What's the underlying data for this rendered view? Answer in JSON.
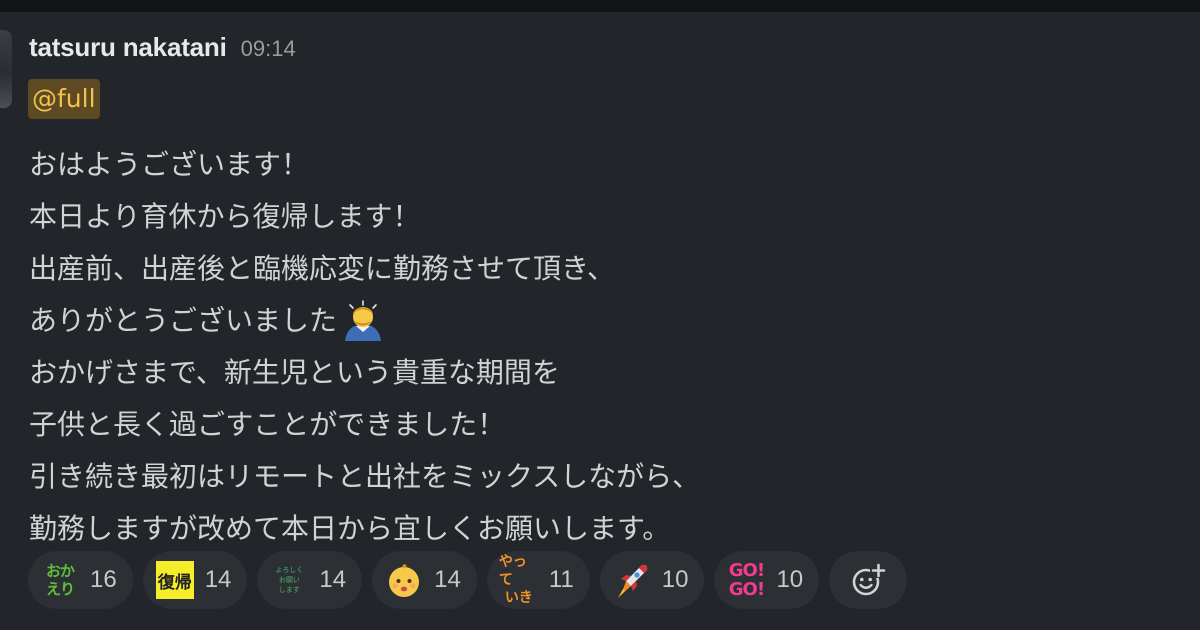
{
  "message": {
    "author": "tatsuru nakatani",
    "time": "09:14",
    "mention": "@full",
    "lines": [
      "おはようございます！",
      "本日より育休から復帰します！",
      "出産前、出産後と臨機応変に勤務させて頂き、",
      "ありがとうございました",
      "おかげさまで、新生児という貴重な期間を",
      "子供と長く過ごすことができました！",
      "引き続き最初はリモートと出社をミックスしながら、",
      "勤務しますが改めて本日から宜しくお願いします。"
    ],
    "inline_emoji": "bowing-person-emoji"
  },
  "reactions": [
    {
      "emoji": "okaeri",
      "label_lines": [
        "おか",
        "えり"
      ],
      "count": "16"
    },
    {
      "emoji": "fukki",
      "label_lines": [
        "復帰"
      ],
      "count": "14"
    },
    {
      "emoji": "yoroshiku-onegaishimasu",
      "label_lines": [
        "よろしく",
        "お願い",
        "します"
      ],
      "count": "14"
    },
    {
      "emoji": "baby-face",
      "label_lines": [],
      "count": "14"
    },
    {
      "emoji": "yatte-iki",
      "label_lines": [
        "やって",
        "いき"
      ],
      "count": "11"
    },
    {
      "emoji": "rocket",
      "label_lines": [],
      "count": "10"
    },
    {
      "emoji": "gogo",
      "label_lines": [
        "GO!",
        "GO!"
      ],
      "count": "10"
    }
  ],
  "add_reaction": {
    "icon": "add-reaction-icon"
  },
  "colors": {
    "background": "#222529",
    "text": "#d1d2d3",
    "mention_bg": "#5e4a22",
    "mention_text": "#f2c14e",
    "reaction_bg": "#2c2f34"
  }
}
